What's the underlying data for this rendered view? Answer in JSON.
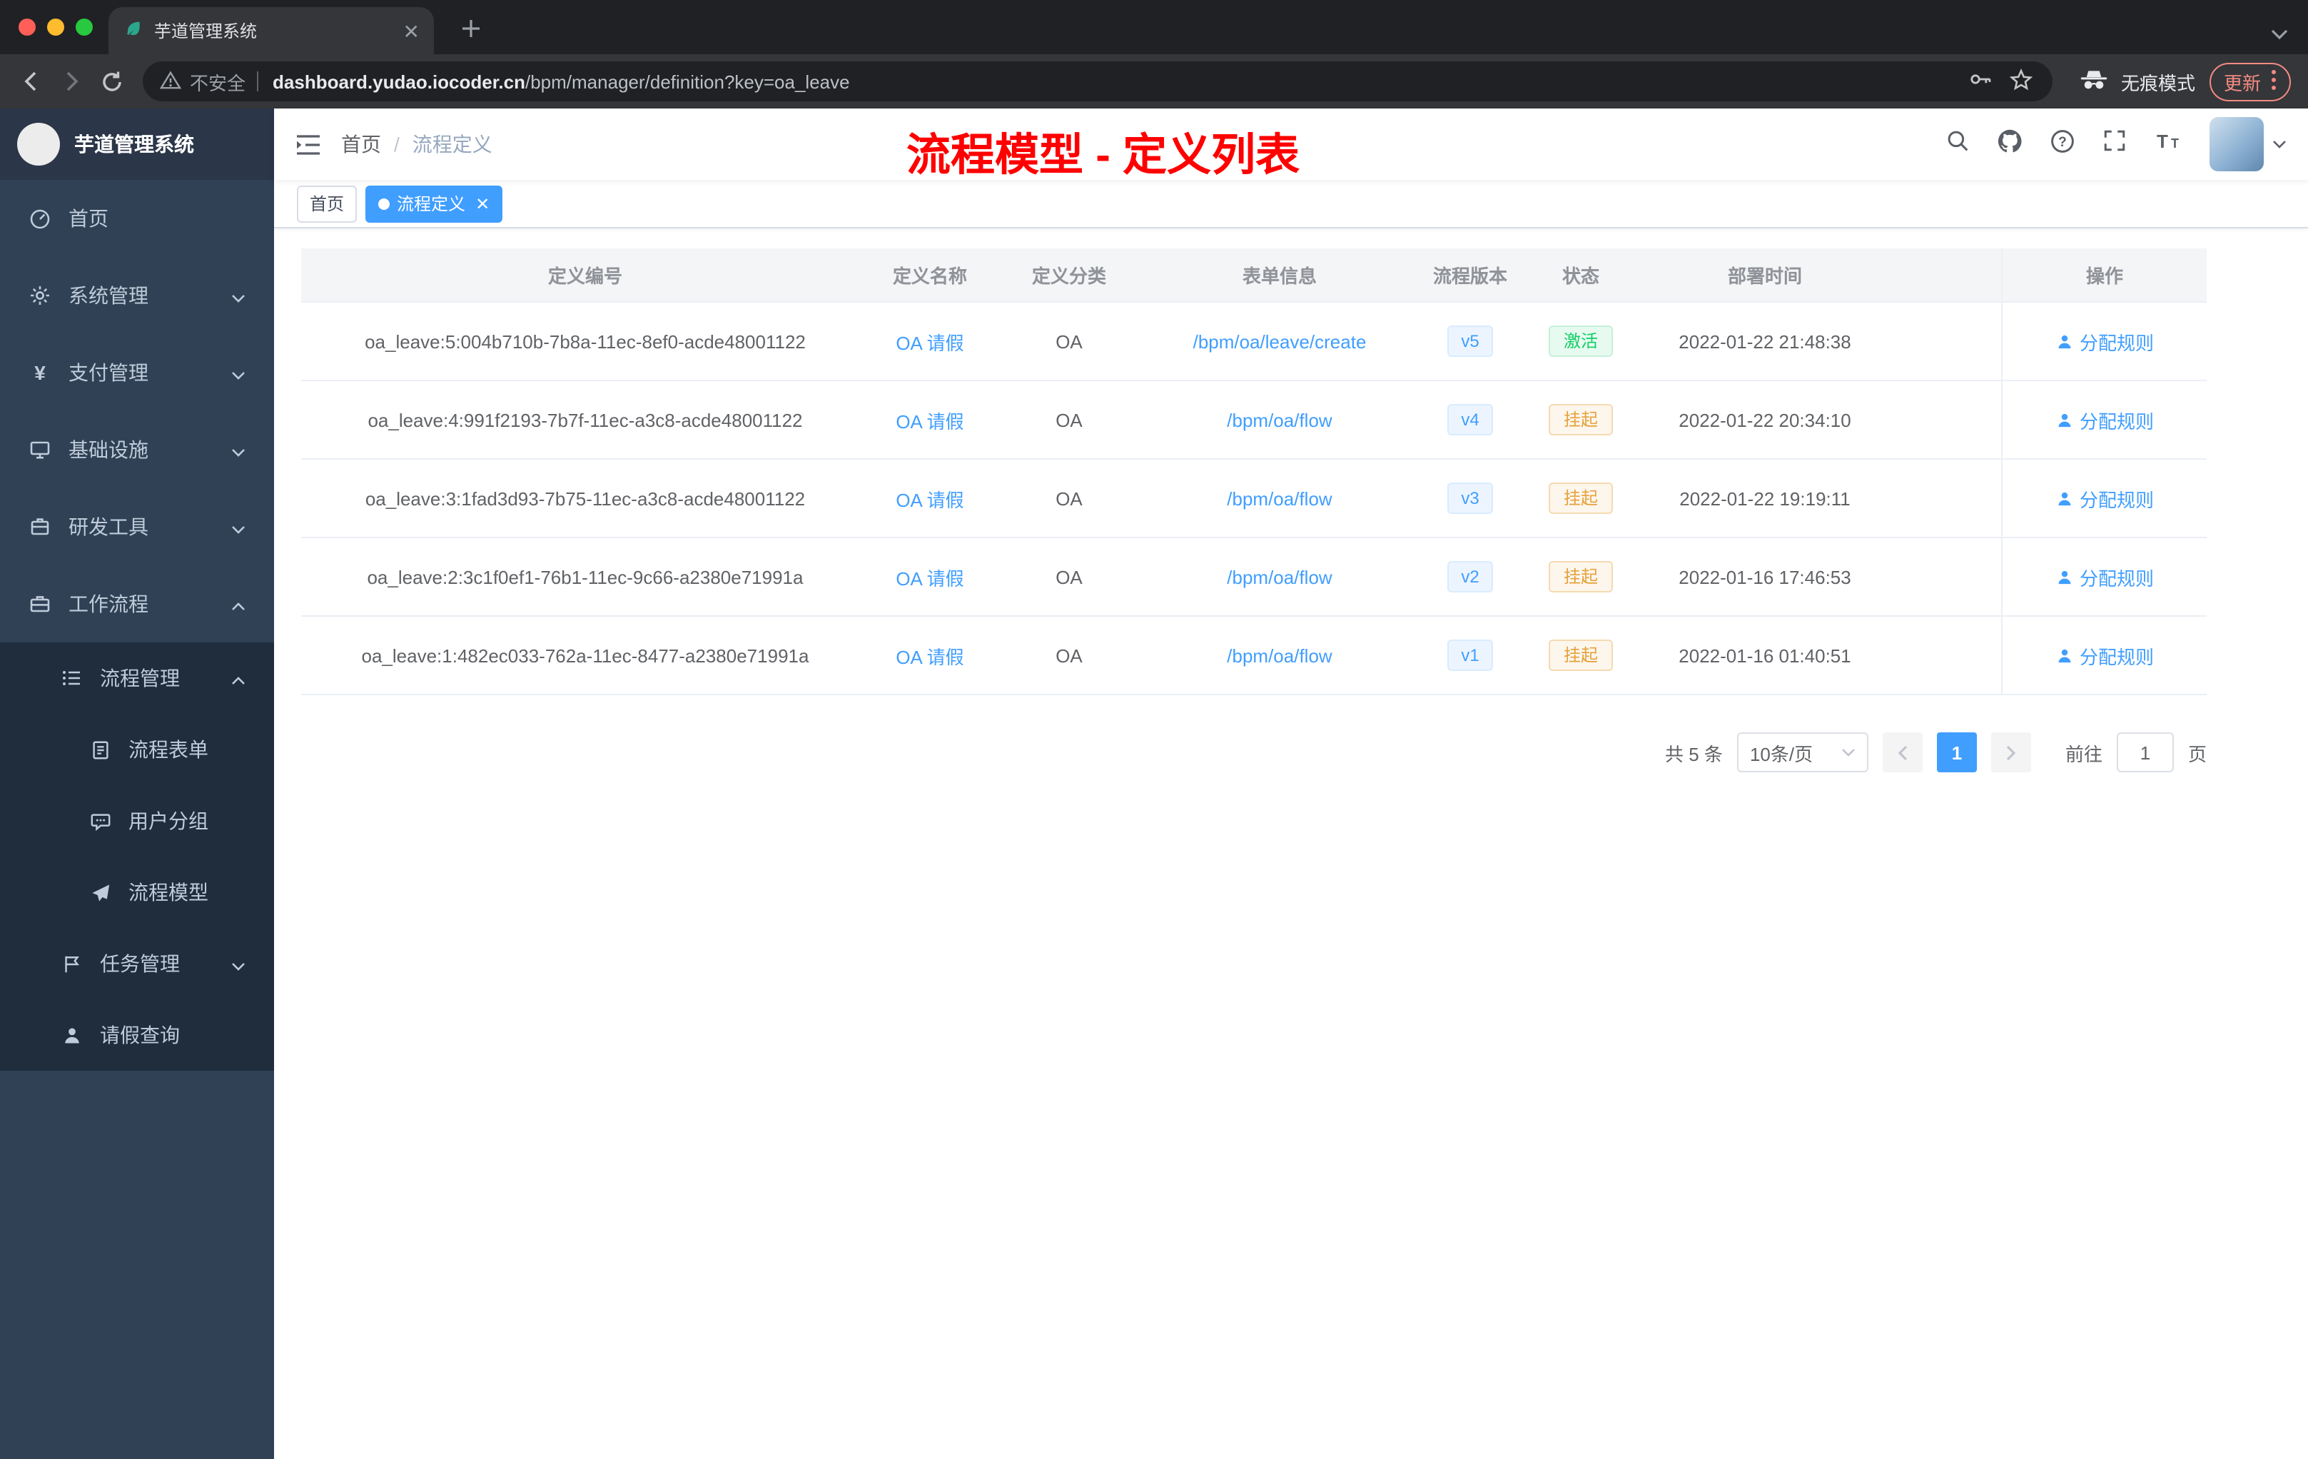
{
  "browser": {
    "tab_title": "芋道管理系统",
    "security_label": "不安全",
    "url_domain": "dashboard.yudao.iocoder.cn",
    "url_path": "/bpm/manager/definition?key=oa_leave",
    "incognito_label": "无痕模式",
    "update_label": "更新"
  },
  "sidebar": {
    "title": "芋道管理系统",
    "menu": [
      {
        "label": "首页"
      },
      {
        "label": "系统管理"
      },
      {
        "label": "支付管理"
      },
      {
        "label": "基础设施"
      },
      {
        "label": "研发工具"
      },
      {
        "label": "工作流程"
      }
    ],
    "process_group": {
      "label": "流程管理"
    },
    "process_children": [
      {
        "label": "流程表单"
      },
      {
        "label": "用户分组"
      },
      {
        "label": "流程模型"
      }
    ],
    "task_group": {
      "label": "任务管理"
    },
    "leave_item": {
      "label": "请假查询"
    }
  },
  "topbar": {
    "breadcrumb_home": "首页",
    "breadcrumb_sep": "/",
    "breadcrumb_current": "流程定义",
    "annotation": "流程模型 - 定义列表"
  },
  "tags": {
    "home": "首页",
    "current": "流程定义"
  },
  "table": {
    "columns": [
      "定义编号",
      "定义名称",
      "定义分类",
      "表单信息",
      "流程版本",
      "状态",
      "部署时间",
      "操作"
    ],
    "rows": [
      {
        "id": "oa_leave:5:004b710b-7b8a-11ec-8ef0-acde48001122",
        "name": "OA 请假",
        "category": "OA",
        "form": "/bpm/oa/leave/create",
        "version": "v5",
        "status": "激活",
        "time": "2022-01-22 21:48:38",
        "action": "分配规则"
      },
      {
        "id": "oa_leave:4:991f2193-7b7f-11ec-a3c8-acde48001122",
        "name": "OA 请假",
        "category": "OA",
        "form": "/bpm/oa/flow",
        "version": "v4",
        "status": "挂起",
        "time": "2022-01-22 20:34:10",
        "action": "分配规则"
      },
      {
        "id": "oa_leave:3:1fad3d93-7b75-11ec-a3c8-acde48001122",
        "name": "OA 请假",
        "category": "OA",
        "form": "/bpm/oa/flow",
        "version": "v3",
        "status": "挂起",
        "time": "2022-01-22 19:19:11",
        "action": "分配规则"
      },
      {
        "id": "oa_leave:2:3c1f0ef1-76b1-11ec-9c66-a2380e71991a",
        "name": "OA 请假",
        "category": "OA",
        "form": "/bpm/oa/flow",
        "version": "v2",
        "status": "挂起",
        "time": "2022-01-16 17:46:53",
        "action": "分配规则"
      },
      {
        "id": "oa_leave:1:482ec033-762a-11ec-8477-a2380e71991a",
        "name": "OA 请假",
        "category": "OA",
        "form": "/bpm/oa/flow",
        "version": "v1",
        "status": "挂起",
        "time": "2022-01-16 01:40:51",
        "action": "分配规则"
      }
    ]
  },
  "pagination": {
    "total": "共 5 条",
    "page_size": "10条/页",
    "page": "1",
    "goto_label": "前往",
    "goto_value": "1",
    "goto_unit": "页"
  },
  "colors": {
    "accent": "#409eff",
    "annotation_red": "#ff0000",
    "status_active": "#13ce66",
    "status_suspended": "#e6a23c",
    "sidebar_bg": "#304156",
    "submenu_bg": "#1f2d3d"
  }
}
